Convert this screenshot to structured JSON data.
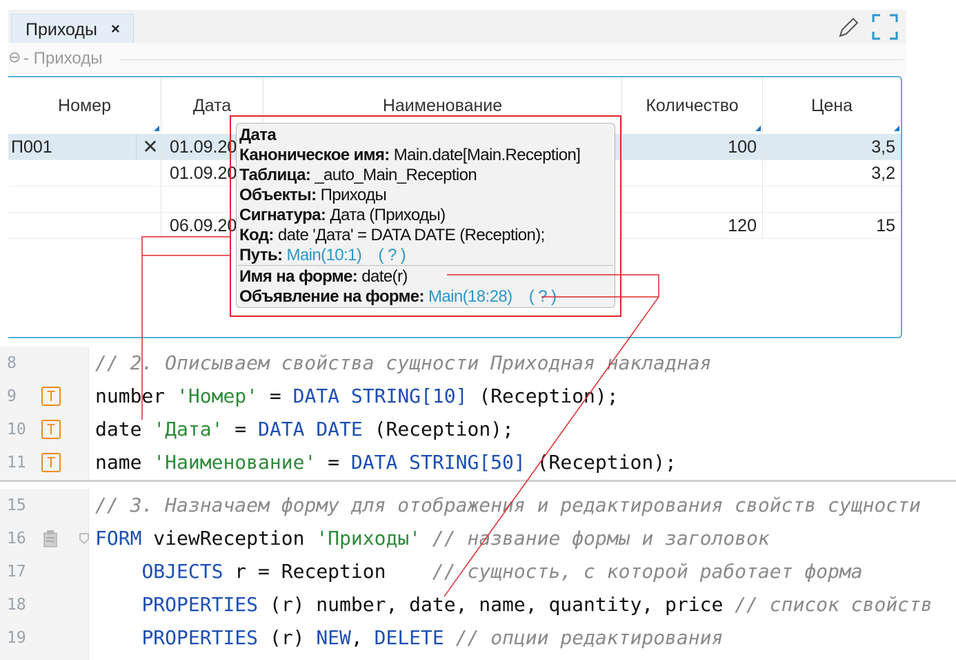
{
  "tab": {
    "label": "Приходы",
    "close": "×"
  },
  "group": {
    "title": "Приходы"
  },
  "grid": {
    "columns": [
      "Номер",
      "Дата",
      "Наименование",
      "Количество",
      "Цена"
    ],
    "rows": [
      {
        "number": "П001",
        "date": "01.09.20",
        "name": "",
        "qty": "100",
        "price": "3,5"
      },
      {
        "number": "",
        "date": "01.09.20",
        "name": "",
        "qty": "",
        "price": "3,2"
      },
      {
        "number": "",
        "date": "",
        "name": "",
        "qty": "",
        "price": ""
      },
      {
        "number": "",
        "date": "06.09.20",
        "name": "",
        "qty": "120",
        "price": "15"
      }
    ]
  },
  "tooltip": {
    "title": "Дата",
    "canonical_label": "Каноническое имя:",
    "canonical_value": "Main.date[Main.Reception]",
    "table_label": "Таблица:",
    "table_value": "_auto_Main_Reception",
    "objects_label": "Объекты:",
    "objects_value": "Приходы",
    "signature_label": "Сигнатура:",
    "signature_value": "Дата (Приходы)",
    "code_label": "Код:",
    "code_value": "date 'Дата' = DATA DATE (Reception);",
    "path_label": "Путь:",
    "path_link": "Main(10:1)",
    "path_help": "( ? )",
    "form_name_label": "Имя на форме:",
    "form_name_value": "date(r)",
    "form_decl_label": "Объявление на форме:",
    "form_decl_link": "Main(18:28)",
    "form_decl_help": "( ? )"
  },
  "code_top": [
    {
      "num": "8",
      "marker": "",
      "text": "// 2. Описываем свойства сущности Приходная накладная"
    },
    {
      "num": "9",
      "marker": "T",
      "text": "number 'Номер' = DATA STRING[10] (Reception);"
    },
    {
      "num": "10",
      "marker": "T",
      "text": "date 'Дата' = DATA DATE (Reception);"
    },
    {
      "num": "11",
      "marker": "T",
      "text": "name 'Наименование' = DATA STRING[50] (Reception);"
    }
  ],
  "code_bottom": [
    {
      "num": "15",
      "text": "// 3. Назначаем форму для отображения и редактирования свойств сущности"
    },
    {
      "num": "16",
      "text": "FORM viewReception 'Приходы' // название формы и заголовок"
    },
    {
      "num": "17",
      "text": "    OBJECTS r = Reception    // сущность, с которой работает форма"
    },
    {
      "num": "18",
      "text": "    PROPERTIES (r) number, date, name, quantity, price // список свойств"
    },
    {
      "num": "19",
      "text": "    PROPERTIES (r) NEW, DELETE // опции редактирования"
    }
  ],
  "colors": {
    "accent": "#5aaed6",
    "annotation": "#e0262c",
    "keyword": "#1d4fb5",
    "string": "#2e8b3a",
    "comment": "#8a8a8a",
    "link": "#2a97c9"
  }
}
